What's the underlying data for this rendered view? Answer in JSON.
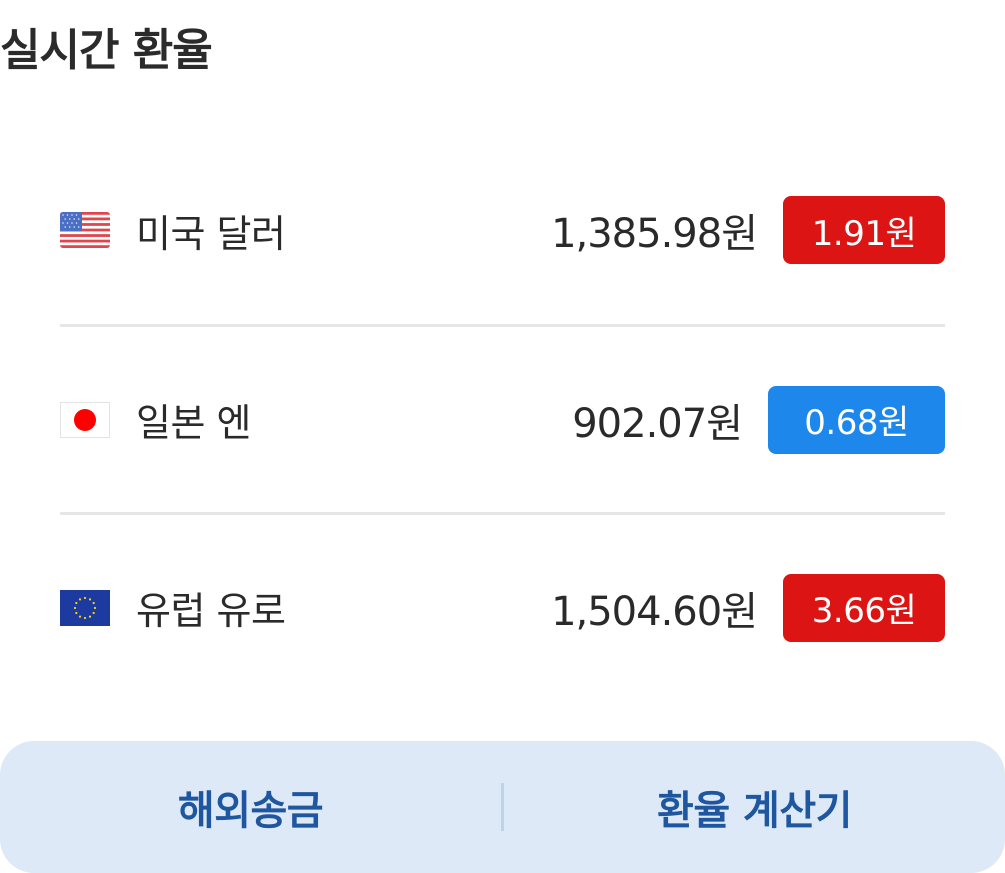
{
  "header": {
    "title": "실시간 환율"
  },
  "rates": [
    {
      "flag": "us-flag-icon",
      "name": "미국 달러",
      "value": "1,385.98원",
      "change": "1.91원",
      "direction": "up"
    },
    {
      "flag": "japan-flag-icon",
      "name": "일본 엔",
      "value": "902.07원",
      "change": "0.68원",
      "direction": "down"
    },
    {
      "flag": "eu-flag-icon",
      "name": "유럽 유로",
      "value": "1,504.60원",
      "change": "3.66원",
      "direction": "up"
    }
  ],
  "bottom_bar": {
    "remittance_label": "해외송금",
    "calculator_label": "환율 계산기"
  },
  "colors": {
    "up": "#dc1414",
    "down": "#1e87ec",
    "bar_background": "#dde9f6",
    "bar_text": "#1f56a0"
  }
}
